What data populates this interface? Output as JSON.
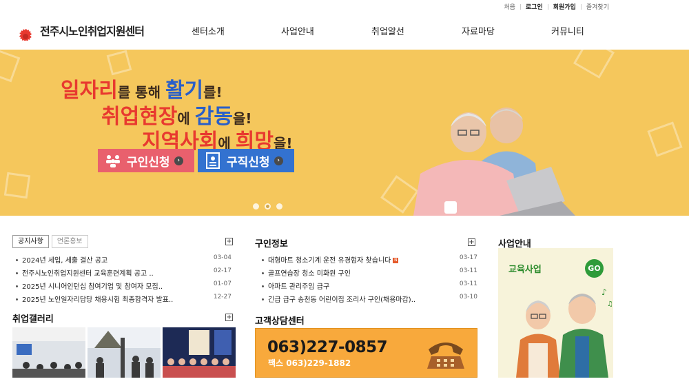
{
  "util_links": [
    "처음",
    "로그인",
    "회원가입",
    "즐겨찾기"
  ],
  "logo": {
    "text": "전주시노인취업지원센터",
    "brand_color": "#e8392f"
  },
  "gnb": [
    "센터소개",
    "사업안내",
    "취업알선",
    "자료마당",
    "커뮤니티"
  ],
  "banner": {
    "line1": {
      "a": "일자리",
      "b": "를 통해 ",
      "c": "활기",
      "d": "를!"
    },
    "line2": {
      "a": "취업현장",
      "b": "에 ",
      "c": "감동",
      "d": "을!"
    },
    "line3": {
      "a": "지역사회",
      "b": "에 ",
      "c": "희망",
      "d": "을!"
    },
    "btn_job_offer": "구인신청",
    "btn_job_seek": "구직신청",
    "slide_count": 3,
    "active_slide": 2,
    "bg_color": "#f5c75c"
  },
  "notice": {
    "tab_active": "공지사항",
    "tab_inactive": "언론홍보",
    "items": [
      {
        "title": "2024년 세입, 세출 결산 공고",
        "date": "03-04"
      },
      {
        "title": "전주시노인취업지원센터 교육훈련계획 공고 ..",
        "date": "02-17"
      },
      {
        "title": "2025년 시니어인턴십 참여기업 및 참여자 모집..",
        "date": "01-07"
      },
      {
        "title": "2025년 노인일자리담당 채용시험 최종합격자 발표..",
        "date": "12-27"
      }
    ]
  },
  "gallery": {
    "title": "취업갤러리"
  },
  "jobs": {
    "title": "구인정보",
    "items": [
      {
        "title": "대형마트 청소기계 운전 유경험자 찾습니다",
        "date": "03-17",
        "new": "N"
      },
      {
        "title": "골프연습장 청소 미화원 구인",
        "date": "03-11"
      },
      {
        "title": "아파트 관리주임 급구",
        "date": "03-11"
      },
      {
        "title": "긴급 급구 송천동 어린이집 조리사 구인(채용마감)..",
        "date": "03-10"
      }
    ]
  },
  "contact": {
    "title": "고객상담센터",
    "phone": "063)227-0857",
    "fax": "팩스 063)229-1882"
  },
  "business": {
    "title": "사업안내",
    "label": "교육사업",
    "go": "GO"
  }
}
